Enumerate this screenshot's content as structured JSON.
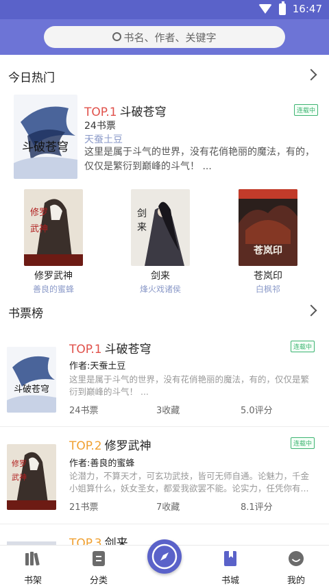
{
  "status_bar": {
    "time": "16:47"
  },
  "search": {
    "placeholder": "书名、作者、关键字"
  },
  "hot_today": {
    "title": "今日热门",
    "featured": {
      "rank": "TOP.1",
      "title": "斗破苍穹",
      "votes": "24书票",
      "author": "天蚕土豆",
      "description": "这里是属于斗气的世界，没有花俏艳丽的魔法，有的，仅仅是繁衍到巅峰的斗气！ ...",
      "badge": "连载中",
      "cover_text": "斗破苍穹"
    },
    "grid": [
      {
        "name": "修罗武神",
        "author": "善良的蜜蜂",
        "cover_text": "修罗武神"
      },
      {
        "name": "剑来",
        "author": "烽火戏诸侯",
        "cover_text": "剑来"
      },
      {
        "name": "苍岚印",
        "author": "白枫祁",
        "cover_text": "苍岚印"
      }
    ]
  },
  "ticket_rank": {
    "title": "书票榜",
    "items": [
      {
        "rank": "TOP.1",
        "title": "斗破苍穹",
        "author": "作者:天蚕土豆",
        "description": "这里是属于斗气的世界，没有花俏艳丽的魔法，有的，仅仅是繁衍到巅峰的斗气！ ...",
        "votes": "24书票",
        "favorites": "3收藏",
        "score": "5.0评分",
        "badge": "连载中",
        "cover_text": "斗破苍穹"
      },
      {
        "rank": "TOP.2",
        "title": "修罗武神",
        "author": "作者:善良的蜜蜂",
        "description": "论潜力，不算天才，可玄功武技，皆可无师自通。论魅力，千金小姐算什么，妖女圣女，都爱我欲罢不能。论实力，任凭你有...",
        "votes": "21书票",
        "favorites": "7收藏",
        "score": "8.1评分",
        "badge": "连载中",
        "cover_text": "修罗武神"
      },
      {
        "rank": "TOP.3",
        "title": "剑来"
      }
    ]
  },
  "bottom_nav": {
    "items": [
      {
        "label": "书架",
        "icon": "bookshelf-icon"
      },
      {
        "label": "分类",
        "icon": "category-icon"
      },
      {
        "label": "",
        "icon": "compass-icon"
      },
      {
        "label": "书城",
        "icon": "bookstore-icon"
      },
      {
        "label": "我的",
        "icon": "profile-icon"
      }
    ]
  },
  "colors": {
    "header": "#6d74d6",
    "status_bar": "#5a62c9",
    "rank_red": "#e0504a",
    "rank_orange": "#f0a030",
    "badge_green": "#3cb371",
    "author_blue": "#8a99c8"
  }
}
